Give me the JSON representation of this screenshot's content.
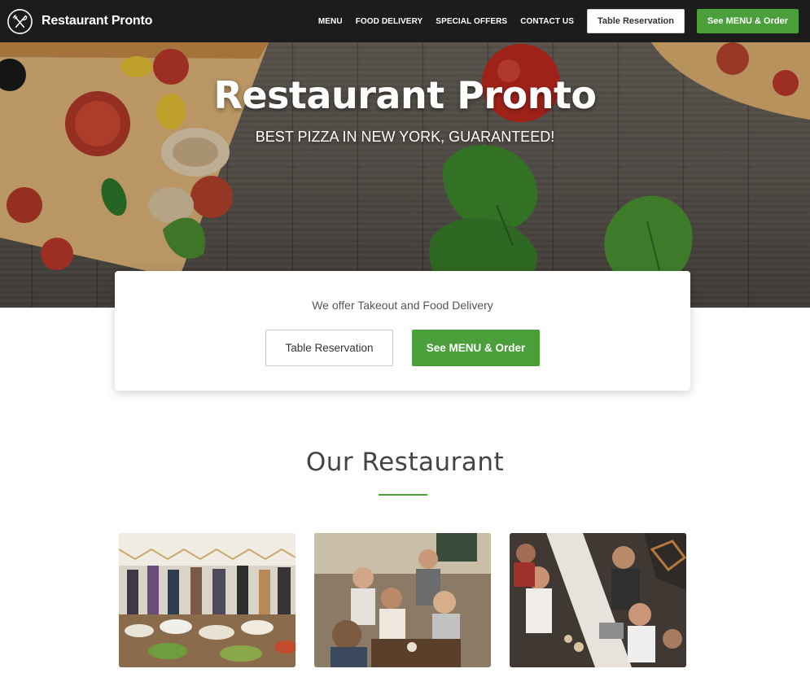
{
  "navbar": {
    "brand_name": "Restaurant Pronto",
    "links": [
      "MENU",
      "FOOD DELIVERY",
      "SPECIAL OFFERS",
      "CONTACT US"
    ],
    "reservation_label": "Table Reservation",
    "order_label": "See MENU & Order"
  },
  "hero": {
    "title": "Restaurant Pronto",
    "subtitle": "BEST PIZZA IN NEW YORK, GUARANTEED!"
  },
  "cta": {
    "text": "We offer Takeout and Food Delivery",
    "reservation_label": "Table Reservation",
    "order_label": "See MENU & Order"
  },
  "section": {
    "title": "Our Restaurant"
  },
  "colors": {
    "accent": "#4a9f3b",
    "navbar": "#1c1c1c"
  },
  "icons": {
    "brand": "fork-knife-icon"
  }
}
